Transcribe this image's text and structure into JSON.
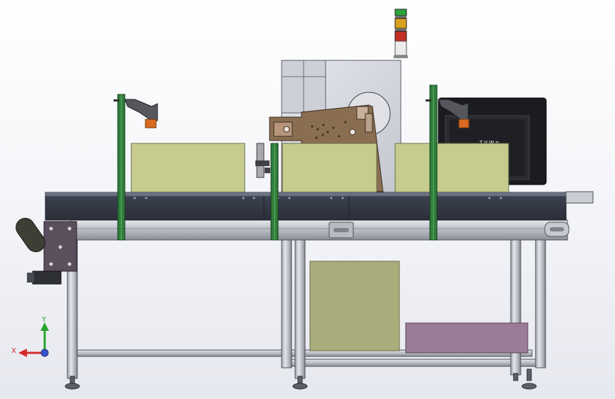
{
  "scene": {
    "title": "",
    "view": "front"
  },
  "triad": {
    "x_label": "X",
    "y_label": "Y",
    "x_color": "#d42a2a",
    "y_color": "#26a32a",
    "z_color": "#3355cc"
  },
  "monitor": {
    "screen_text": "T V W n"
  },
  "colors": {
    "frame_aluminium": "#c9ccd3",
    "frame_stroke": "#4a4d55",
    "conveyor_belt": "#3c4150",
    "box_olive": "#c6cb8e",
    "box_olive_low": "#a9ad7c",
    "box_purple": "#9a7c98",
    "post_green": "#2f7d3a",
    "panel_glass": "#d3d6dd",
    "labeler_brown": "#8a6e52",
    "monitor_body": "#1b1c20",
    "stack_light": [
      "#2ea43a",
      "#d9a21e",
      "#c22e25",
      "#e6e6e6"
    ]
  },
  "icons": [
    "axis-triad-icon",
    "stack-light-icon",
    "scanner-icon"
  ]
}
